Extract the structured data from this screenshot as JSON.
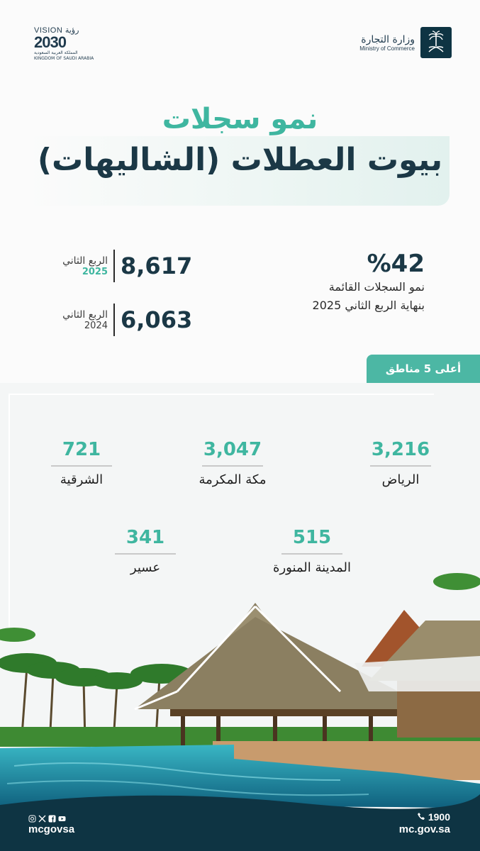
{
  "header": {
    "vision_top": "VISION رؤية",
    "vision_year": "2030",
    "vision_ar": "المملكة العربية السعودية",
    "vision_en": "KINGDOM OF SAUDI ARABIA",
    "ministry_ar": "وزارة التجارة",
    "ministry_en": "Ministry of Commerce"
  },
  "title": {
    "line1": "نمو سجلات",
    "line2": "بيوت العطلات (الشاليهات)"
  },
  "stats": {
    "q2025": {
      "quarter": "الربع الثاني",
      "year": "2025",
      "value": "8,617"
    },
    "q2024": {
      "quarter": "الربع الثاني",
      "year": "2024",
      "value": "6,063"
    },
    "growth": {
      "percent": "%42",
      "line1": "نمو السجلات القائمة",
      "line2": "بنهاية الربع الثاني 2025"
    }
  },
  "top_regions": {
    "tab_label": "أعلى 5 مناطق",
    "items": [
      {
        "name": "الرياض",
        "value": "3,216"
      },
      {
        "name": "مكة المكرمة",
        "value": "3,047"
      },
      {
        "name": "الشرقية",
        "value": "721"
      },
      {
        "name": "المدينة المنورة",
        "value": "515"
      },
      {
        "name": "عسير",
        "value": "341"
      }
    ]
  },
  "footer": {
    "handle": "mcgovsa",
    "phone": "1900",
    "website": "mc.gov.sa",
    "social_icons": [
      "instagram-icon",
      "x-icon",
      "facebook-icon",
      "youtube-icon"
    ]
  },
  "colors": {
    "accent": "#3fb6a0",
    "navy": "#1b3846",
    "tab": "#4cb7a4",
    "footer": "#0e3443"
  }
}
